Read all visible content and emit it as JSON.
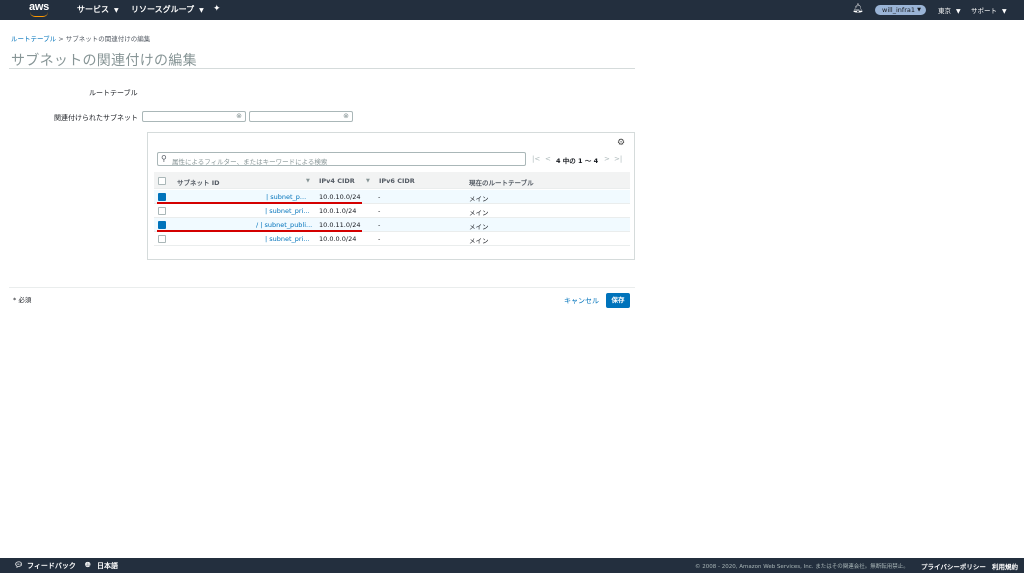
{
  "nav": {
    "logo_text": "aws",
    "services": "サービス",
    "resource_groups": "リソースグループ",
    "user": "will_infra1",
    "region": "東京",
    "support": "サポート"
  },
  "breadcrumb": {
    "parent": "ルートテーブル",
    "separator": ">",
    "current": "サブネットの関連付けの編集"
  },
  "page_title": "サブネットの関連付けの編集",
  "form": {
    "route_table_label": "ルートテーブル",
    "associated_subnets_label": "関連付けられたサブネット"
  },
  "table": {
    "filter_placeholder": "属性によるフィルター、またはキーワードによる検索",
    "pagination": "4 中の 1 ～ 4",
    "columns": [
      "サブネット ID",
      "IPv4 CIDR",
      "IPv6 CIDR",
      "現在のルートテーブル"
    ],
    "rows": [
      {
        "subnet_id": "| subnet_p...",
        "ipv4": "10.0.10.0/24",
        "ipv6": "-",
        "route_table": "メイン",
        "selected": true
      },
      {
        "subnet_id": "| subnet_pri...",
        "ipv4": "10.0.1.0/24",
        "ipv6": "-",
        "route_table": "メイン",
        "selected": false
      },
      {
        "subnet_id": "/ | subnet_publi...",
        "ipv4": "10.0.11.0/24",
        "ipv6": "-",
        "route_table": "メイン",
        "selected": true
      },
      {
        "subnet_id": "| subnet_pri...",
        "ipv4": "10.0.0.0/24",
        "ipv6": "-",
        "route_table": "メイン",
        "selected": false
      }
    ]
  },
  "actions": {
    "required": "* 必須",
    "cancel": "キャンセル",
    "save": "保存"
  },
  "footer": {
    "feedback": "フィードバック",
    "language": "日本語",
    "copyright": "© 2008 - 2020, Amazon Web Services, Inc. またはその関連会社。無断転用禁止。",
    "privacy": "プライバシーポリシー",
    "terms": "利用規約"
  },
  "colors": {
    "nav_bg": "#232f3e",
    "accent_orange": "#ff9900",
    "link_blue": "#0073bb",
    "annotation_red": "#d40000"
  }
}
